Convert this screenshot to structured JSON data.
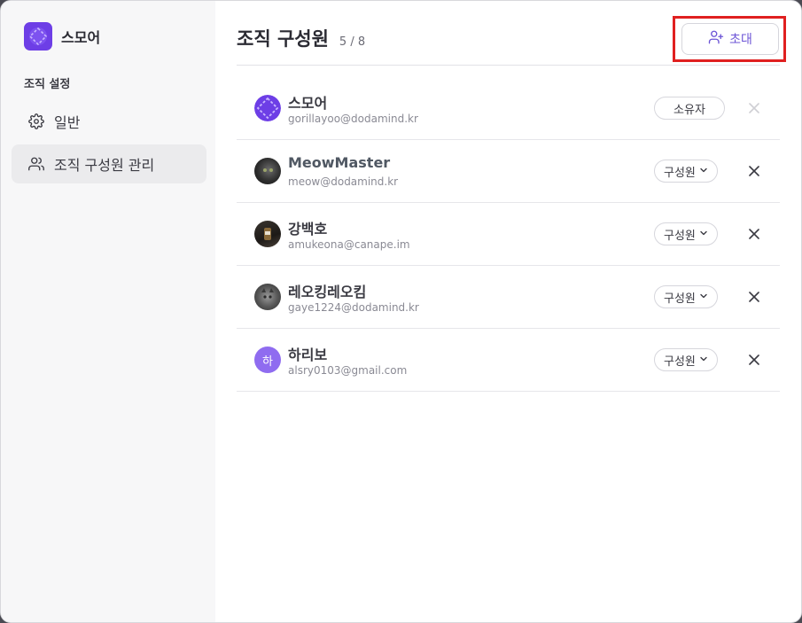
{
  "org": {
    "name": "스모어",
    "logo_icon": "smore-logo-icon",
    "brand_color": "#6d3ee6"
  },
  "sidebar": {
    "section_label": "조직 설정",
    "items": [
      {
        "label": "일반",
        "icon": "gear-icon",
        "active": false
      },
      {
        "label": "조직 구성원 관리",
        "icon": "users-icon",
        "active": true
      }
    ]
  },
  "header": {
    "title": "조직 구성원",
    "count": "5 / 8",
    "invite_label": "초대"
  },
  "members": [
    {
      "name": "스모어",
      "email": "gorillayoo@dodamind.kr",
      "role": "소유자",
      "removable": false,
      "avatar": "logo"
    },
    {
      "name": "MeowMaster",
      "email": "meow@dodamind.kr",
      "role": "구성원",
      "removable": true,
      "avatar": "photo-cat-dark"
    },
    {
      "name": "강백호",
      "email": "amukeona@canape.im",
      "role": "구성원",
      "removable": true,
      "avatar": "photo-drink"
    },
    {
      "name": "레오킹레오킴",
      "email": "gaye1224@dodamind.kr",
      "role": "구성원",
      "removable": true,
      "avatar": "photo-cat-tabby"
    },
    {
      "name": "하리보",
      "email": "alsry0103@gmail.com",
      "role": "구성원",
      "removable": true,
      "avatar": "initial",
      "initial": "하"
    }
  ]
}
